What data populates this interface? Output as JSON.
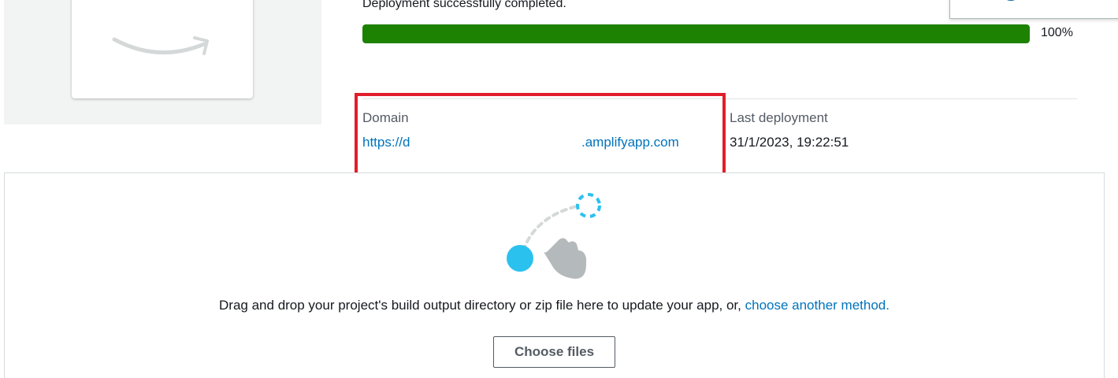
{
  "deployment": {
    "status_text": "Deployment successfully completed.",
    "progress_percent": 100,
    "progress_label": "100%"
  },
  "details": {
    "domain_label": "Domain",
    "domain_prefix": "https://d",
    "domain_suffix": ".amplifyapp.com",
    "last_deployment_label": "Last deployment",
    "last_deployment_value": "31/1/2023, 19:22:51"
  },
  "dropzone": {
    "instruction_text": "Drag and drop your project's build output directory or zip file here to update your app, or, ",
    "method_link": "choose another method.",
    "choose_button": "Choose files"
  },
  "colors": {
    "progress_fill": "#1d8102",
    "link": "#0073bb",
    "highlight": "#e11d2b"
  }
}
